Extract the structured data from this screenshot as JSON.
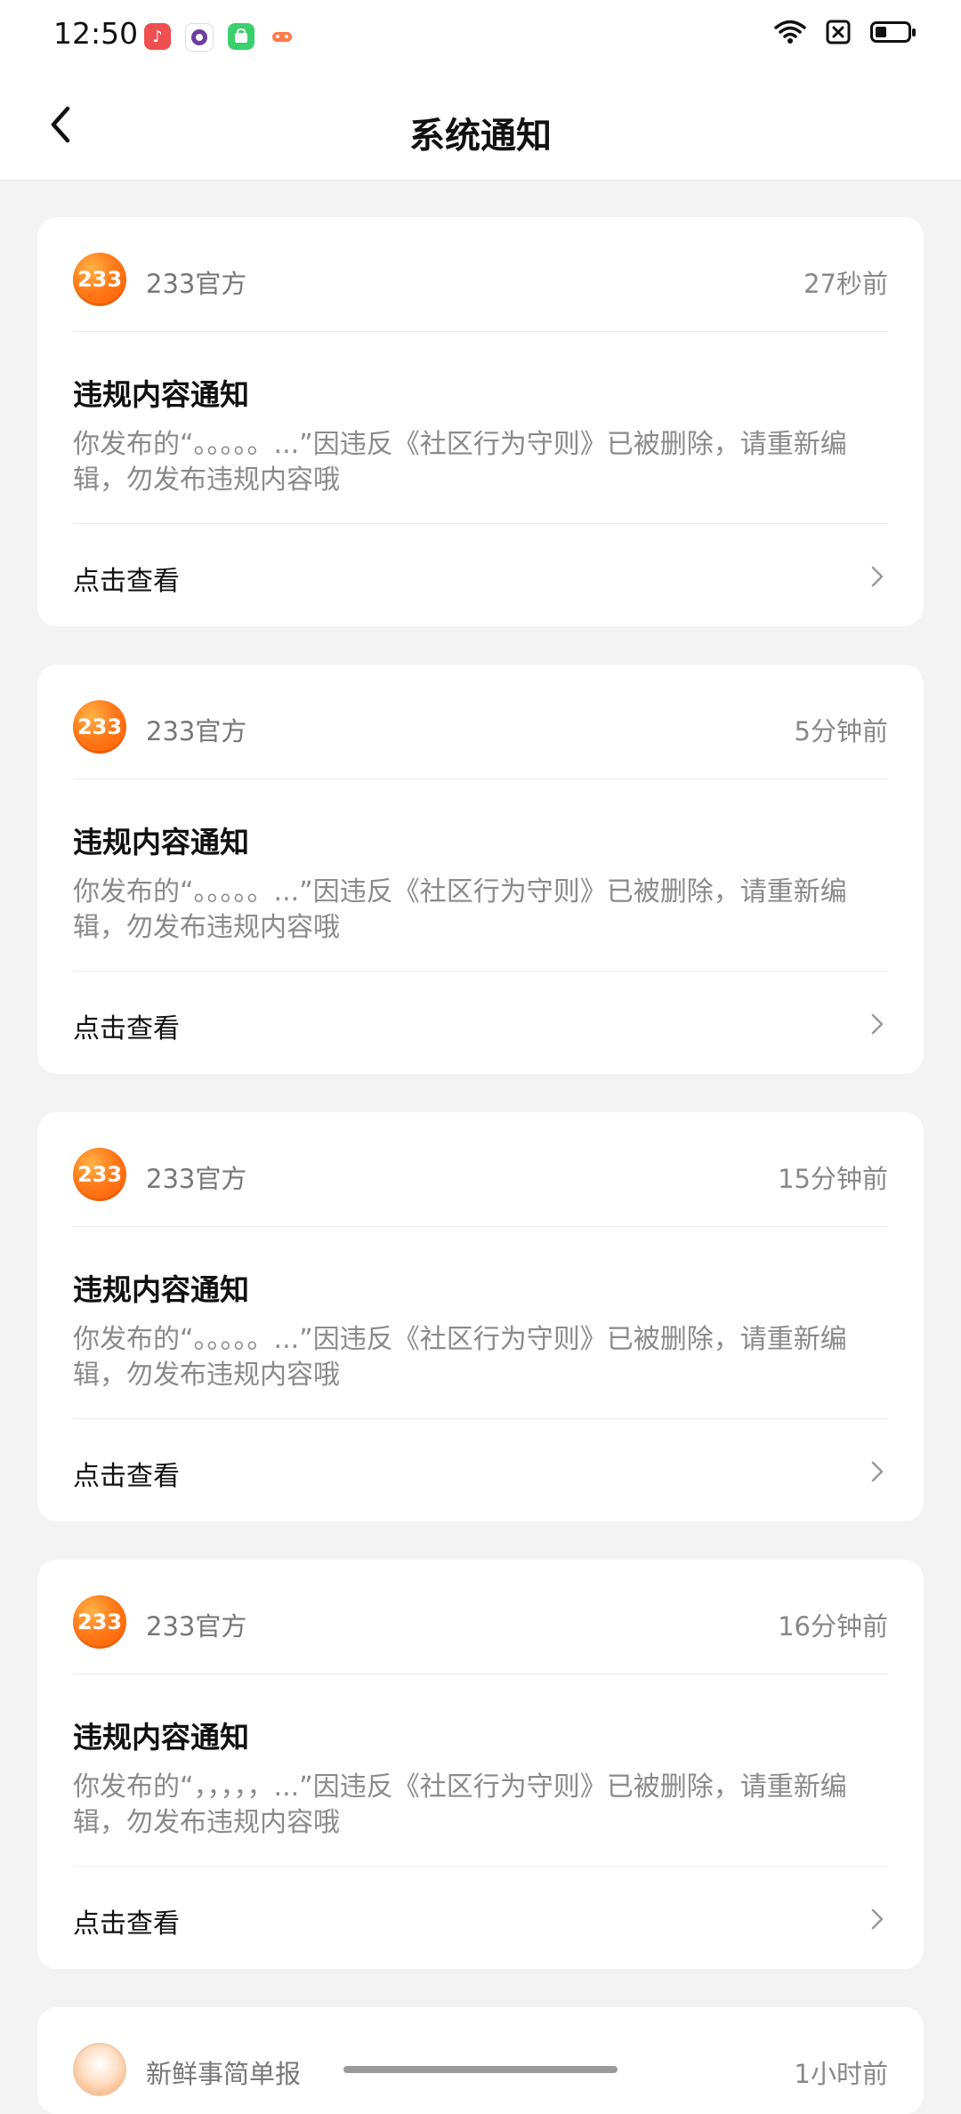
{
  "status": {
    "time": "12:50"
  },
  "header": {
    "title": "系统通知"
  },
  "cards": [
    {
      "sender": "233官方",
      "time": "27秒前",
      "avatar_text": "233",
      "title": "违规内容通知",
      "body": "你发布的“。。。。。...”因违反《社区行为守则》已被删除，请重新编辑，勿发布违规内容哦",
      "action": "点击查看"
    },
    {
      "sender": "233官方",
      "time": "5分钟前",
      "avatar_text": "233",
      "title": "违规内容通知",
      "body": "你发布的“。。。。。...”因违反《社区行为守则》已被删除，请重新编辑，勿发布违规内容哦",
      "action": "点击查看"
    },
    {
      "sender": "233官方",
      "time": "15分钟前",
      "avatar_text": "233",
      "title": "违规内容通知",
      "body": "你发布的“。。。。。...”因违反《社区行为守则》已被删除，请重新编辑，勿发布违规内容哦",
      "action": "点击查看"
    },
    {
      "sender": "233官方",
      "time": "16分钟前",
      "avatar_text": "233",
      "title": "违规内容通知",
      "body": "你发布的“，，，，，...”因违反《社区行为守则》已被删除，请重新编辑，勿发布违规内容哦",
      "action": "点击查看"
    }
  ],
  "partial_card": {
    "sender": "新鲜事简单报",
    "time": "1小时前"
  },
  "colors": {
    "background": "#f3f3f3",
    "card": "#ffffff",
    "brand_orange": "#ff6a00",
    "muted_text": "#8a8a8a"
  }
}
